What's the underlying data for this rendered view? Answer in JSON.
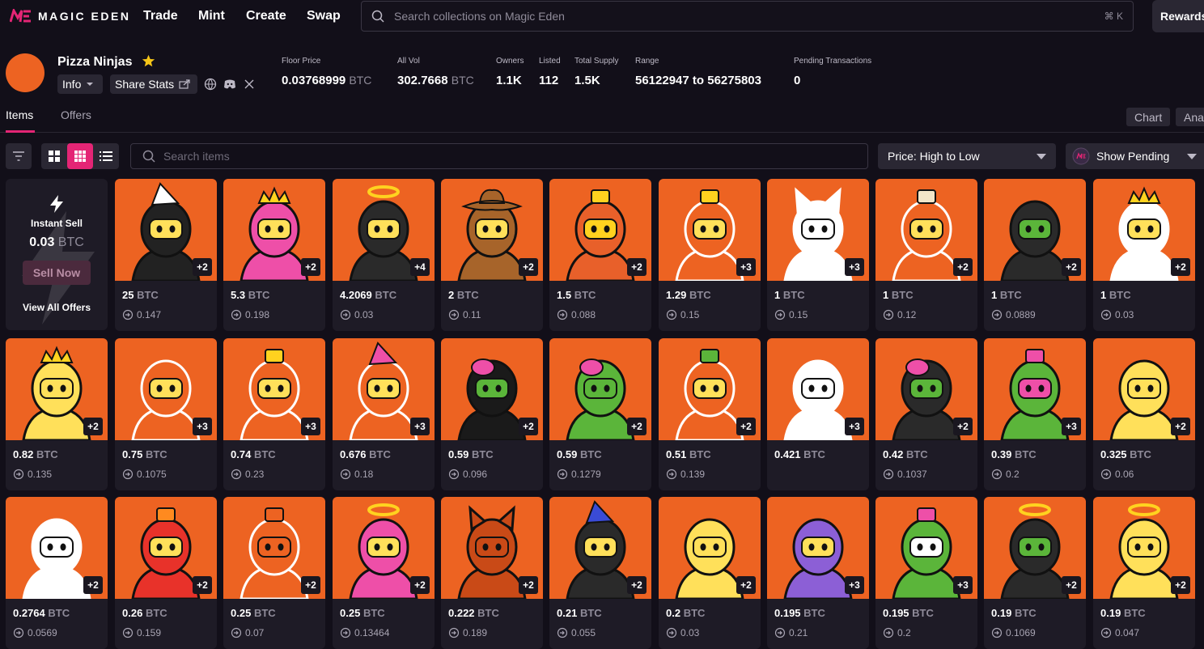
{
  "brand": {
    "name": "MAGIC EDEN",
    "accent": "#e42575",
    "art_bg": "#ed6322"
  },
  "nav": [
    "Trade",
    "Mint",
    "Create",
    "Swap"
  ],
  "search": {
    "placeholder": "Search collections on Magic Eden",
    "shortcut": "⌘ K"
  },
  "rewards_label": "Rewards",
  "collection": {
    "name": "Pizza Ninjas",
    "info_label": "Info",
    "share_label": "Share Stats",
    "stats": [
      {
        "label": "Floor Price",
        "value": "0.03768999",
        "unit": "BTC"
      },
      {
        "label": "All Vol",
        "value": "302.7668",
        "unit": "BTC"
      },
      {
        "label": "Owners",
        "value": "1.1K",
        "unit": ""
      },
      {
        "label": "Listed",
        "value": "112",
        "unit": ""
      },
      {
        "label": "Total Supply",
        "value": "1.5K",
        "unit": ""
      },
      {
        "label": "Range",
        "value": "56122947 to 56275803",
        "unit": ""
      },
      {
        "label": "Pending Transactions",
        "value": "0",
        "unit": ""
      }
    ]
  },
  "tabs": {
    "items": "Items",
    "offers": "Offers",
    "chart": "Chart",
    "analytics": "Ana"
  },
  "toolbar": {
    "items_search_placeholder": "Search items",
    "sort_label": "Price: High to Low",
    "pending_label": "Show Pending"
  },
  "instant_sell": {
    "title": "Instant Sell",
    "price": "0.03",
    "unit": "BTC",
    "button": "Sell Now",
    "view_all": "View All Offers"
  },
  "unit": "BTC",
  "items": [
    {
      "price": "25",
      "last": "0.147",
      "badge": "+2",
      "hat": "dunce",
      "hood": "#222",
      "face": "#ffe05a"
    },
    {
      "price": "5.3",
      "last": "0.198",
      "badge": "+2",
      "hat": "crown",
      "hood": "#ee4fa8",
      "face": "#ffe05a"
    },
    {
      "price": "4.2069",
      "last": "0.03",
      "badge": "+4",
      "hat": "halo",
      "hood": "#2a2a2a",
      "face": "#ffe05a"
    },
    {
      "price": "2",
      "last": "0.11",
      "badge": "+2",
      "hat": "cowboy",
      "hood": "#a7642a",
      "face": "#ffe05a"
    },
    {
      "price": "1.5",
      "last": "0.088",
      "badge": "+2",
      "hat": "tv",
      "hood": "#e8602a",
      "face": "#ffd21f"
    },
    {
      "price": "1.29",
      "last": "0.15",
      "badge": "+3",
      "hat": "pizzabox",
      "hood": "#ed6322",
      "face": "#ffe05a"
    },
    {
      "price": "1",
      "last": "0.15",
      "badge": "+3",
      "hat": "ears",
      "hood": "#ffffff",
      "face": "#ffffff"
    },
    {
      "price": "1",
      "last": "0.12",
      "badge": "+2",
      "hat": "spool",
      "hood": "#ed6322",
      "face": "#ffe05a"
    },
    {
      "price": "1",
      "last": "0.0889",
      "badge": "+2",
      "hat": "none",
      "hood": "#2a2a2a",
      "face": "#5bb53a"
    },
    {
      "price": "1",
      "last": "0.03",
      "badge": "+2",
      "hat": "crown",
      "hood": "#ffffff",
      "face": "#ffe05a"
    },
    {
      "price": "0.82",
      "last": "0.135",
      "badge": "+2",
      "hat": "crown",
      "hood": "#ffe05a",
      "face": "#ffe05a"
    },
    {
      "price": "0.75",
      "last": "0.1075",
      "badge": "+3",
      "hat": "none",
      "hood": "#ed6322",
      "face": "#ffe05a"
    },
    {
      "price": "0.74",
      "last": "0.23",
      "badge": "+3",
      "hat": "cheese",
      "hood": "#ed6322",
      "face": "#ffe05a"
    },
    {
      "price": "0.676",
      "last": "0.18",
      "badge": "+3",
      "hat": "party",
      "hood": "#ed6322",
      "face": "#ffe05a"
    },
    {
      "price": "0.59",
      "last": "0.096",
      "badge": "+2",
      "hat": "brain",
      "hood": "#1a1a1a",
      "face": "#5bb53a"
    },
    {
      "price": "0.59",
      "last": "0.1279",
      "badge": "+2",
      "hat": "brain",
      "hood": "#5bb53a",
      "face": "#5bb53a"
    },
    {
      "price": "0.51",
      "last": "0.139",
      "badge": "+2",
      "hat": "leaf",
      "hood": "#ed6322",
      "face": "#ffe05a"
    },
    {
      "price": "0.421",
      "last": "",
      "badge": "+3",
      "hat": "none",
      "hood": "#ffffff",
      "face": "#ffffff"
    },
    {
      "price": "0.42",
      "last": "0.1037",
      "badge": "+2",
      "hat": "brain",
      "hood": "#2a2a2a",
      "face": "#5bb53a"
    },
    {
      "price": "0.39",
      "last": "0.2",
      "badge": "+3",
      "hat": "bandana",
      "hood": "#5bb53a",
      "face": "#ee4fa8"
    },
    {
      "price": "0.325",
      "last": "0.06",
      "badge": "+2",
      "hat": "none",
      "hood": "#ffe05a",
      "face": "#ffe05a"
    },
    {
      "price": "0.2764",
      "last": "0.0569",
      "badge": "+2",
      "hat": "none",
      "hood": "#ffffff",
      "face": "#ffffff"
    },
    {
      "price": "0.26",
      "last": "0.159",
      "badge": "+2",
      "hat": "fire",
      "hood": "#e8322a",
      "face": "#ffe05a"
    },
    {
      "price": "0.25",
      "last": "0.07",
      "badge": "+2",
      "hat": "bow",
      "hood": "#ed6322",
      "face": "#ed6322"
    },
    {
      "price": "0.25",
      "last": "0.13464",
      "badge": "+2",
      "hat": "halo",
      "hood": "#ee4fa8",
      "face": "#ffe05a"
    },
    {
      "price": "0.222",
      "last": "0.189",
      "badge": "+2",
      "hat": "ears",
      "hood": "#c94a17",
      "face": "#c94a17"
    },
    {
      "price": "0.21",
      "last": "0.055",
      "badge": "+2",
      "hat": "wizard",
      "hood": "#2a2a2a",
      "face": "#ffe05a"
    },
    {
      "price": "0.2",
      "last": "0.03",
      "badge": "+2",
      "hat": "none",
      "hood": "#ffe05a",
      "face": "#ffe05a"
    },
    {
      "price": "0.195",
      "last": "0.21",
      "badge": "+3",
      "hat": "none",
      "hood": "#8c5fd6",
      "face": "#ffe05a"
    },
    {
      "price": "0.195",
      "last": "0.2",
      "badge": "+3",
      "hat": "bandana",
      "hood": "#5bb53a",
      "face": "#ffffff"
    },
    {
      "price": "0.19",
      "last": "0.1069",
      "badge": "+2",
      "hat": "halo",
      "hood": "#2a2a2a",
      "face": "#5bb53a"
    },
    {
      "price": "0.19",
      "last": "0.047",
      "badge": "+2",
      "hat": "halo",
      "hood": "#ffe05a",
      "face": "#ffe05a"
    }
  ]
}
